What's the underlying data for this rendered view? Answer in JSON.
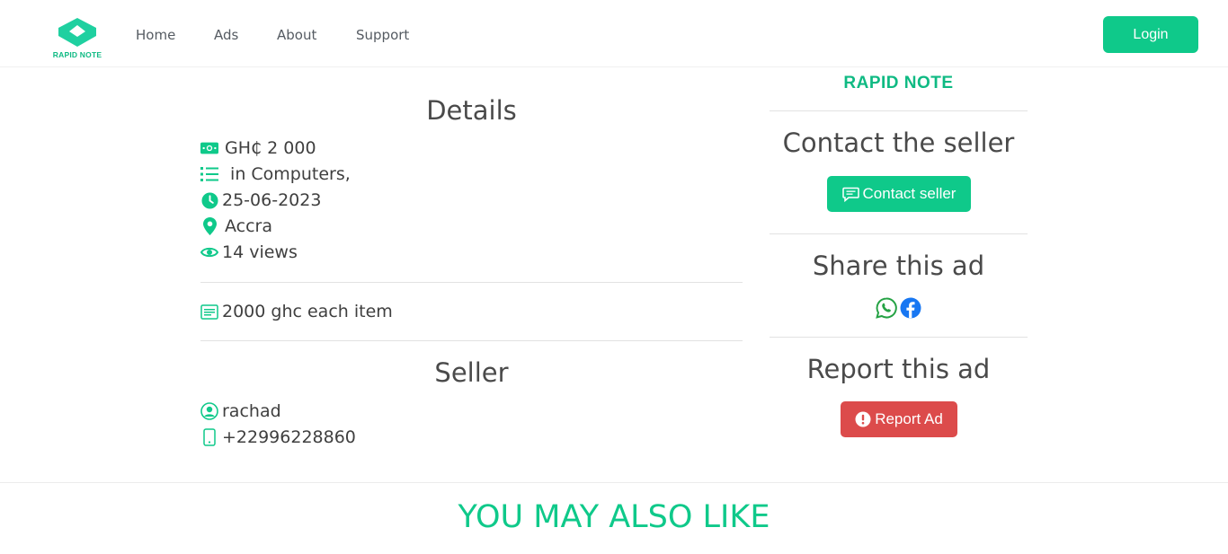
{
  "header": {
    "logo_text": "RAPID NOTE",
    "nav": [
      {
        "label": "Home"
      },
      {
        "label": "Ads"
      },
      {
        "label": "About"
      },
      {
        "label": "Support"
      }
    ],
    "login_label": "Login"
  },
  "details": {
    "title": "Details",
    "price": "GH₵ 2 000",
    "category": " in Computers,",
    "date": "25-06-2023",
    "location": "Accra",
    "views": "14 views",
    "description": "2000 ghc each item"
  },
  "seller": {
    "title": "Seller",
    "name": "rachad",
    "phone": "+22996228860"
  },
  "sidebar": {
    "brand": "RAPID NOTE",
    "contact_title": "Contact the seller",
    "contact_button": "Contact seller",
    "share_title": "Share this ad",
    "report_title": "Report this ad",
    "report_button": "Report Ad"
  },
  "related": {
    "title": "YOU MAY ALSO LIKE"
  },
  "colors": {
    "accent": "#0fc98a",
    "danger": "#dc4b4b",
    "whatsapp": "#25a244",
    "facebook": "#1877f2"
  }
}
